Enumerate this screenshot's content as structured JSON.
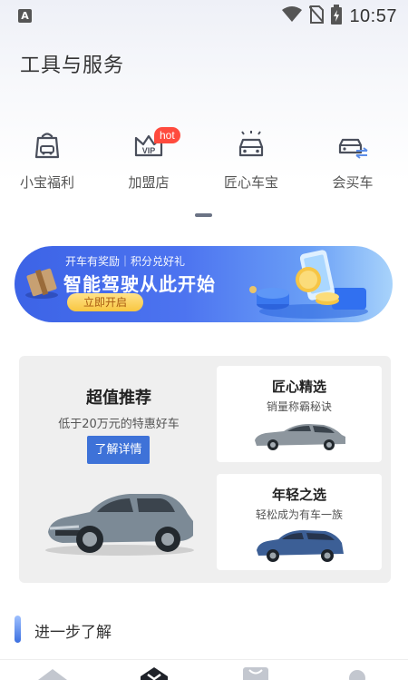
{
  "status_bar": {
    "app_icon_letter": "A",
    "time": "10:57",
    "icons": [
      "wifi-icon",
      "no-sim-icon",
      "battery-charging-icon"
    ]
  },
  "page": {
    "title": "工具与服务"
  },
  "services": [
    {
      "label": "小宝福利",
      "icon": "gift-bag-icon"
    },
    {
      "label": "加盟店",
      "icon": "vip-crown-icon",
      "badge": "hot"
    },
    {
      "label": "匠心车宝",
      "icon": "car-front-icon"
    },
    {
      "label": "会买车",
      "icon": "car-exchange-icon"
    }
  ],
  "banner": {
    "subtitle": "开车有奖励｜积分兑好礼",
    "title": "智能驾驶从此开始",
    "button": "立即开启"
  },
  "recommendation": {
    "title": "超值推荐",
    "subtitle": "低于20万元的特惠好车",
    "button": "了解详情",
    "cards": [
      {
        "title": "匠心精选",
        "subtitle": "销量称霸秘诀"
      },
      {
        "title": "年轻之选",
        "subtitle": "轻松成为有车一族"
      }
    ]
  },
  "section": {
    "title": "进一步了解"
  },
  "bottom_nav": [
    "home-icon",
    "explore-icon",
    "shop-icon",
    "profile-icon"
  ],
  "colors": {
    "accent": "#3e72d8",
    "hot_badge": "#ff4b3e",
    "banner_start": "#3c63e6",
    "banner_button": "#f8c640"
  }
}
